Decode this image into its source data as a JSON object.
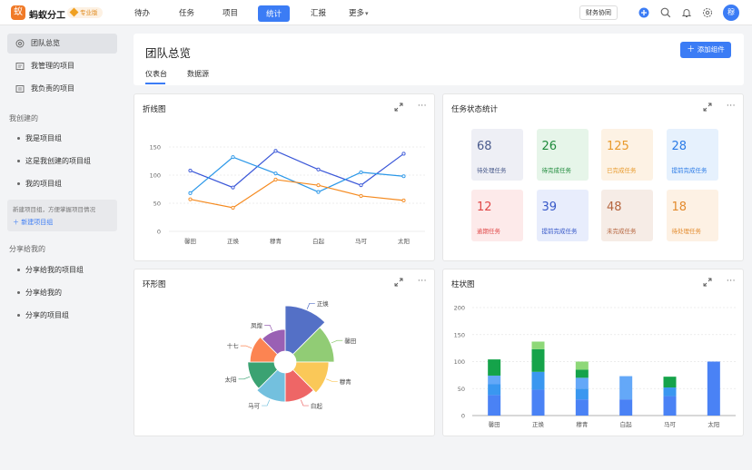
{
  "app": {
    "name": "蚂蚁分工",
    "badge": "专业版",
    "logo_char": "蚁"
  },
  "nav": [
    {
      "label": "待办"
    },
    {
      "label": "任务"
    },
    {
      "label": "项目"
    },
    {
      "label": "统计"
    },
    {
      "label": "汇报"
    },
    {
      "label": "更多"
    }
  ],
  "topbar": {
    "collab_label": "财务协同",
    "avatar_label": "穆",
    "more_glyph": "▾"
  },
  "sidebar": {
    "items": [
      {
        "label": "团队总览",
        "icon": "dashboard-icon"
      },
      {
        "label": "我管理的项目",
        "icon": "managed-projects-icon"
      },
      {
        "label": "我负责的项目",
        "icon": "owned-projects-icon"
      }
    ],
    "my_created": {
      "title": "我创建的",
      "items": [
        "我是项目组",
        "这是我创建的项目组",
        "我的项目组"
      ]
    },
    "hint": {
      "text": "新建项目组，方便掌握项目情况",
      "link": "新建项目组"
    },
    "shared": {
      "title": "分享给我的",
      "items": [
        "分享给我的项目组",
        "分享给我的",
        "分享的项目组"
      ]
    }
  },
  "main": {
    "title": "团队总览",
    "add_button": "添加组件",
    "tabs": [
      {
        "label": "仪表台"
      },
      {
        "label": "数据源"
      }
    ]
  },
  "cards": {
    "line": {
      "title": "折线图"
    },
    "stats": {
      "title": "任务状态统计"
    },
    "ring": {
      "title": "环形图"
    },
    "bar": {
      "title": "柱状图"
    }
  },
  "stats_tiles": [
    {
      "value": "68",
      "label": "待处理任务",
      "bg": "#eeeff5",
      "color": "#4a5b8c"
    },
    {
      "value": "26",
      "label": "待完成任务",
      "bg": "#e6f5e9",
      "color": "#1f8a3c"
    },
    {
      "value": "125",
      "label": "已完成任务",
      "bg": "#fdf2e4",
      "color": "#e89a2c"
    },
    {
      "value": "28",
      "label": "提前完成任务",
      "bg": "#e6f1fd",
      "color": "#2b7be6"
    },
    {
      "value": "12",
      "label": "逾期任务",
      "bg": "#fdeaea",
      "color": "#e04848"
    },
    {
      "value": "39",
      "label": "提前完成任务",
      "bg": "#e8edfc",
      "color": "#3658c8"
    },
    {
      "value": "48",
      "label": "未完成任务",
      "bg": "#f6ece6",
      "color": "#b5653e"
    },
    {
      "value": "18",
      "label": "待处理任务",
      "bg": "#fdf1e4",
      "color": "#e38b2e"
    }
  ],
  "chart_data": [
    {
      "type": "line",
      "categories": [
        "馨田",
        "正焕",
        "穆青",
        "白起",
        "马可",
        "太阳"
      ],
      "ylim": [
        0,
        150
      ],
      "yticks": [
        0,
        50,
        100,
        150
      ],
      "grid": true,
      "series": [
        {
          "values": [
            108,
            78,
            143,
            110,
            82,
            138
          ],
          "color": "#3a57d8"
        },
        {
          "values": [
            68,
            132,
            103,
            70,
            105,
            98
          ],
          "color": "#2a97e8"
        },
        {
          "values": [
            57,
            42,
            92,
            82,
            63,
            55
          ],
          "color": "#f58a1f"
        }
      ]
    },
    {
      "type": "pie",
      "style": "rose-ring",
      "slices": [
        {
          "label": "正焕",
          "value": 100,
          "color": "#5470c6"
        },
        {
          "label": "馨田",
          "value": 80,
          "color": "#91cc75"
        },
        {
          "label": "穆青",
          "value": 65,
          "color": "#fac858"
        },
        {
          "label": "白起",
          "value": 55,
          "color": "#ee6666"
        },
        {
          "label": "马可",
          "value": 55,
          "color": "#73c0de"
        },
        {
          "label": "太阳",
          "value": 48,
          "color": "#3ba272"
        },
        {
          "label": "十七",
          "value": 42,
          "color": "#fc8452"
        },
        {
          "label": "凤煌",
          "value": 35,
          "color": "#9a60b4"
        }
      ]
    },
    {
      "type": "bar",
      "stacked": true,
      "categories": [
        "馨田",
        "正焕",
        "穆青",
        "白起",
        "马可",
        "太阳"
      ],
      "ylim": [
        0,
        200
      ],
      "yticks": [
        0,
        50,
        100,
        150,
        200
      ],
      "grid": true,
      "series": [
        {
          "values": [
            38,
            48,
            30,
            30,
            36,
            100
          ],
          "color": "#4a82f5"
        },
        {
          "values": [
            20,
            33,
            20,
            0,
            16,
            0
          ],
          "color": "#3a97f0"
        },
        {
          "values": [
            16,
            0,
            20,
            43,
            0,
            0
          ],
          "color": "#64a8f8"
        },
        {
          "values": [
            30,
            42,
            15,
            0,
            20,
            0
          ],
          "color": "#15a34a"
        },
        {
          "values": [
            0,
            14,
            15,
            0,
            0,
            0
          ],
          "color": "#8ed878"
        },
        {
          "values": [
            0,
            0,
            0,
            0,
            0,
            0
          ],
          "color": "#f07a75"
        }
      ]
    }
  ]
}
